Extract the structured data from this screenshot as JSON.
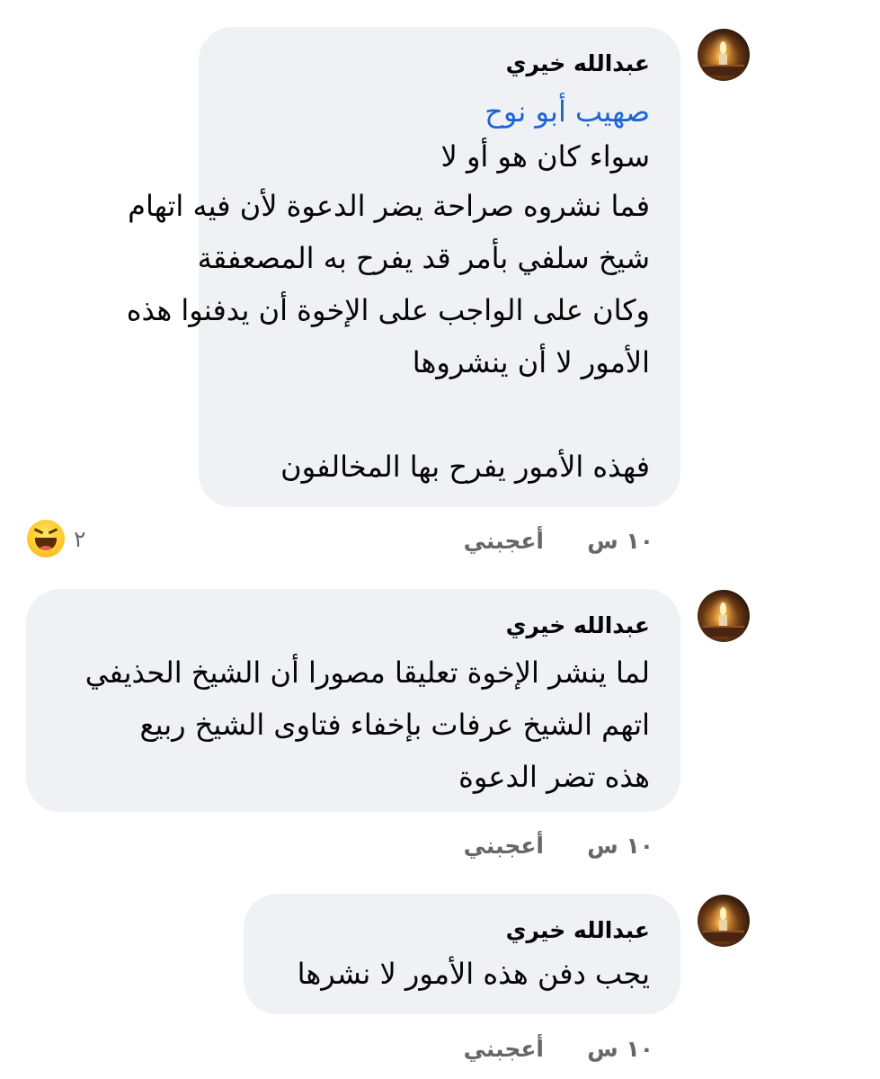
{
  "comments": [
    {
      "author": "عبدالله خيري",
      "mention": "صهيب أبو نوح",
      "lines": [
        "سواء كان هو أو لا",
        "فما نشروه صراحة يضر الدعوة لأن فيه اتهام",
        "شيخ سلفي بأمر قد يفرح به المصعفقة",
        "وكان على الواجب على الإخوة أن يدفنوا هذه",
        "الأمور لا أن ينشروها",
        "",
        "فهذه الأمور يفرح بها المخالفون"
      ],
      "time": "١٠ س",
      "like_label": "أعجبني",
      "reaction_icon": "haha-emoji",
      "reaction_count": "٢"
    },
    {
      "author": "عبدالله خيري",
      "lines": [
        "لما ينشر الإخوة تعليقا مصورا أن الشيخ الحذيفي",
        "اتهم الشيخ عرفات بإخفاء فتاوى الشيخ ربيع",
        "هذه تضر الدعوة"
      ],
      "time": "١٠ س",
      "like_label": "أعجبني"
    },
    {
      "author": "عبدالله خيري",
      "lines": [
        "يجب دفن هذه الأمور لا نشرها"
      ],
      "time": "١٠ س",
      "like_label": "أعجبني"
    }
  ],
  "colors": {
    "bubble": "#f0f1f5",
    "mention": "#1b64d6",
    "meta": "#65676b"
  }
}
